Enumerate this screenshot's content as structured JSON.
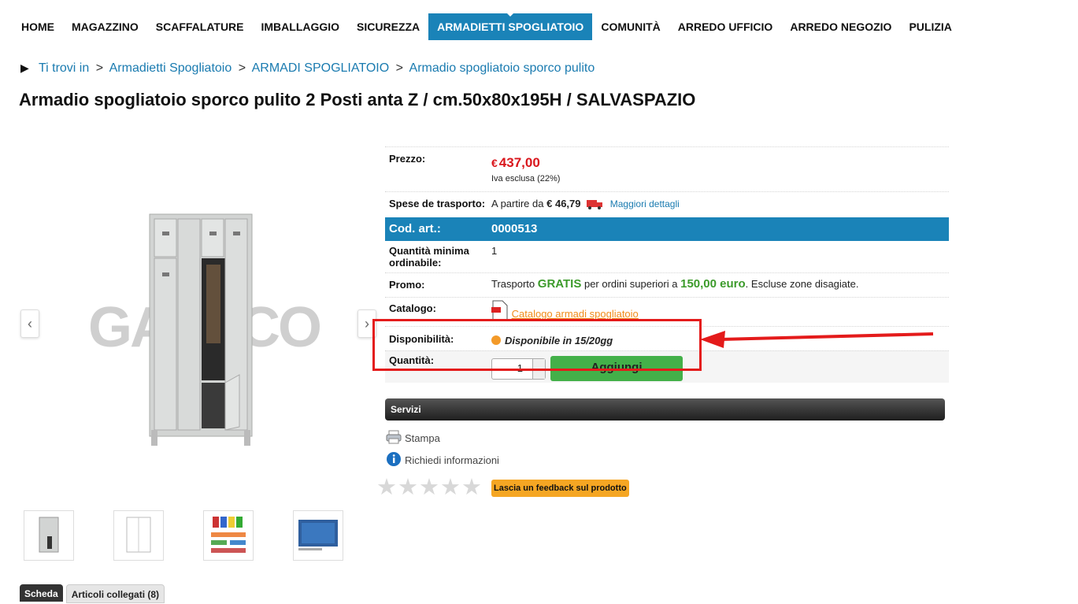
{
  "nav": {
    "items": [
      "HOME",
      "MAGAZZINO",
      "SCAFFALATURE",
      "IMBALLAGGIO",
      "SICUREZZA",
      "ARMADIETTI SPOGLIATOIO",
      "COMUNITÀ",
      "ARREDO UFFICIO",
      "ARREDO NEGOZIO",
      "PULIZIA"
    ],
    "active_index": 5
  },
  "breadcrumb": {
    "prefix": "Ti trovi in",
    "items": [
      "Armadietti Spogliatoio",
      "ARMADI SPOGLIATOIO",
      "Armadio spogliatoio sporco pulito"
    ],
    "separator": ">"
  },
  "product": {
    "title": "Armadio spogliatoio sporco pulito 2 Posti anta Z / cm.50x80x195H / SALVASPAZIO",
    "watermark": "GAESCO"
  },
  "info": {
    "price_label": "Prezzo:",
    "currency": "€",
    "price": "437,00",
    "vat_note": "Iva esclusa (22%)",
    "shipping_label": "Spese de trasporto:",
    "shipping_prefix": "A partire da",
    "shipping_price": "€ 46,79",
    "shipping_link": "Maggiori dettagli",
    "code_label": "Cod. art.:",
    "code_value": "0000513",
    "min_qty_label": "Quantità minima ordinabile:",
    "min_qty_value": "1",
    "promo_label": "Promo:",
    "promo_text_1": "Trasporto",
    "promo_gratis": "GRATIS",
    "promo_text_2": "per ordini superiori a",
    "promo_amount": "150,00 euro",
    "promo_text_3": ". Escluse zone disagiate.",
    "catalog_label": "Catalogo:",
    "catalog_link": "Catalogo armadi spogliatoio",
    "availability_label": "Disponibilità:",
    "availability_value": "Disponibile in 15/20gg",
    "quantity_label": "Quantità:",
    "quantity_value": "1",
    "add_button": "Aggiungi"
  },
  "services": {
    "header": "Servizi",
    "print": "Stampa",
    "request_info": "Richiedi informazioni",
    "feedback_button": "Lascia un feedback sul prodotto"
  },
  "tabs": [
    "Scheda",
    "Articoli collegati (8)"
  ],
  "colors": {
    "accent_blue": "#1a83b8",
    "price_red": "#d9161c",
    "promo_green": "#3c9b2b",
    "annotation_red": "#e41b1b",
    "add_green": "#43b049"
  }
}
